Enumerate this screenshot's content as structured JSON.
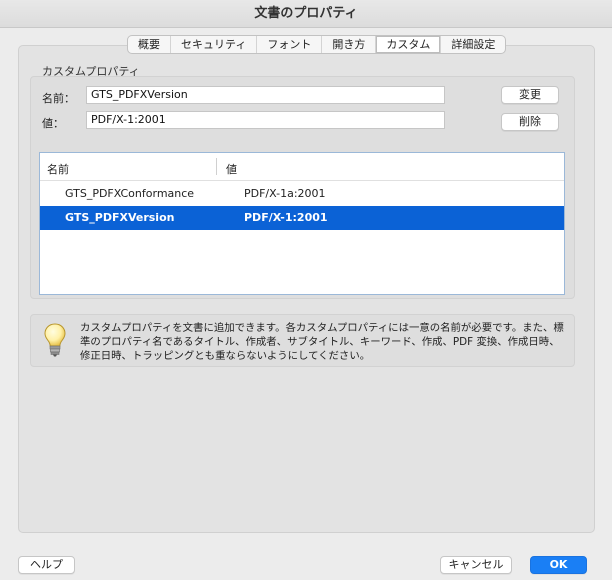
{
  "window": {
    "title": "文書のプロパティ"
  },
  "tabs": [
    {
      "label": "概要"
    },
    {
      "label": "セキュリティ"
    },
    {
      "label": "フォント"
    },
    {
      "label": "開き方"
    },
    {
      "label": "カスタム",
      "active": true
    },
    {
      "label": "詳細設定"
    }
  ],
  "custom": {
    "group_label": "カスタムプロパティ",
    "name_label": "名前：",
    "name_value": "GTS_PDFXVersion",
    "value_label": "値：",
    "value_value": "PDF/X-1:2001",
    "change_button": "変更",
    "delete_button": "削除",
    "table": {
      "headers": [
        "名前",
        "値"
      ],
      "rows": [
        {
          "name": "GTS_PDFXConformance",
          "value": "PDF/X-1a:2001",
          "selected": false
        },
        {
          "name": "GTS_PDFXVersion",
          "value": "PDF/X-1:2001",
          "selected": true
        }
      ]
    }
  },
  "info": {
    "icon": "lightbulb-icon",
    "text": "カスタムプロパティを文書に追加できます。各カスタムプロパティには一意の名前が必要です。また、標準のプロパティ名であるタイトル、作成者、サブタイトル、キーワード、作成、PDF 変換、作成日時、修正日時、トラッピングとも重ならないようにしてください。"
  },
  "footer": {
    "help_button": "ヘルプ",
    "cancel_button": "キャンセル",
    "ok_button": "OK"
  },
  "colors": {
    "accent": "#1a7ff5",
    "selection": "#0b62d6"
  }
}
